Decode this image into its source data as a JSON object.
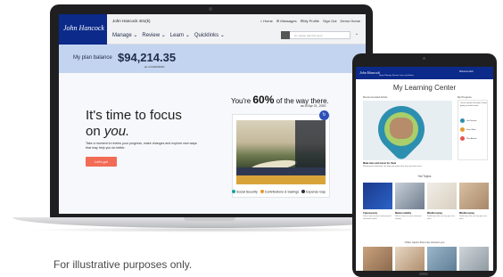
{
  "laptop": {
    "brand": "John Hancock",
    "plan_name": "John Hancock 401(k)",
    "util_nav": [
      {
        "icon": "home-icon",
        "label": "Home"
      },
      {
        "icon": "envelope-icon",
        "label": "Messages"
      },
      {
        "icon": "gear-icon",
        "label": "My Profile"
      },
      {
        "icon": "",
        "label": "Sign Out"
      },
      {
        "icon": "",
        "label": "Demo Home"
      }
    ],
    "main_nav": [
      "Manage",
      "Review",
      "Learn",
      "Quicklinks"
    ],
    "search_placeholder": "Or maybe ask this store",
    "balance_label": "My plan balance",
    "balance_value": "$94,214.35",
    "balance_asof": "as of 04/20/2020",
    "focus_line1": "It's time to focus",
    "focus_line2_pre": "on ",
    "focus_line2_em": "you.",
    "focus_body": "Take a moment to review your progress, make changes and explore new ways that may help you do better.",
    "cta": "Let's go!",
    "progress_pre": "You're ",
    "progress_pct": "60%",
    "progress_post": " of the way there.",
    "progress_asof": "as of Apr 21, 2020",
    "legend": [
      {
        "label": "Social Security",
        "color": "#17a3a1"
      },
      {
        "label": "Contributions & Savings",
        "color": "#e79b2b"
      },
      {
        "label": "Expense Gap",
        "color": "#2a2f3d"
      }
    ]
  },
  "tablet": {
    "brand": "John Hancock",
    "nav": "Home  Manage  Review  Learn  Quicklinks",
    "user": "Welcome back",
    "title": "My Learning Center",
    "recommended": "Recommended Article",
    "my_progress": "My Progress",
    "progress_text": "You've earned 10 points. Keep going to unlock more.",
    "progress_items": [
      {
        "label": "Get Started",
        "color": "#2d8fb0"
      },
      {
        "label": "Save More",
        "color": "#e79b2b"
      },
      {
        "label": "Plan Ahead",
        "color": "#e5534b"
      }
    ],
    "hero_caption": "Make time and invest for them",
    "hero_body": "Planning for retirement can help you protect the ones you love most.",
    "hot_topics": "Hot Topics",
    "tiles": [
      {
        "title": "Cybersecurity",
        "desc": "Protect your accounts and personal information online."
      },
      {
        "title": "Market volatility",
        "desc": "What it means for your retirement savings."
      },
      {
        "title": "Mindful saving",
        "desc": "Small steps that can help you save more."
      },
      {
        "title": "Mindful saving",
        "desc": "Small steps that can help you save more."
      }
    ],
    "other_topics": "Other topics that may interest you"
  },
  "caption": "For illustrative purposes only."
}
